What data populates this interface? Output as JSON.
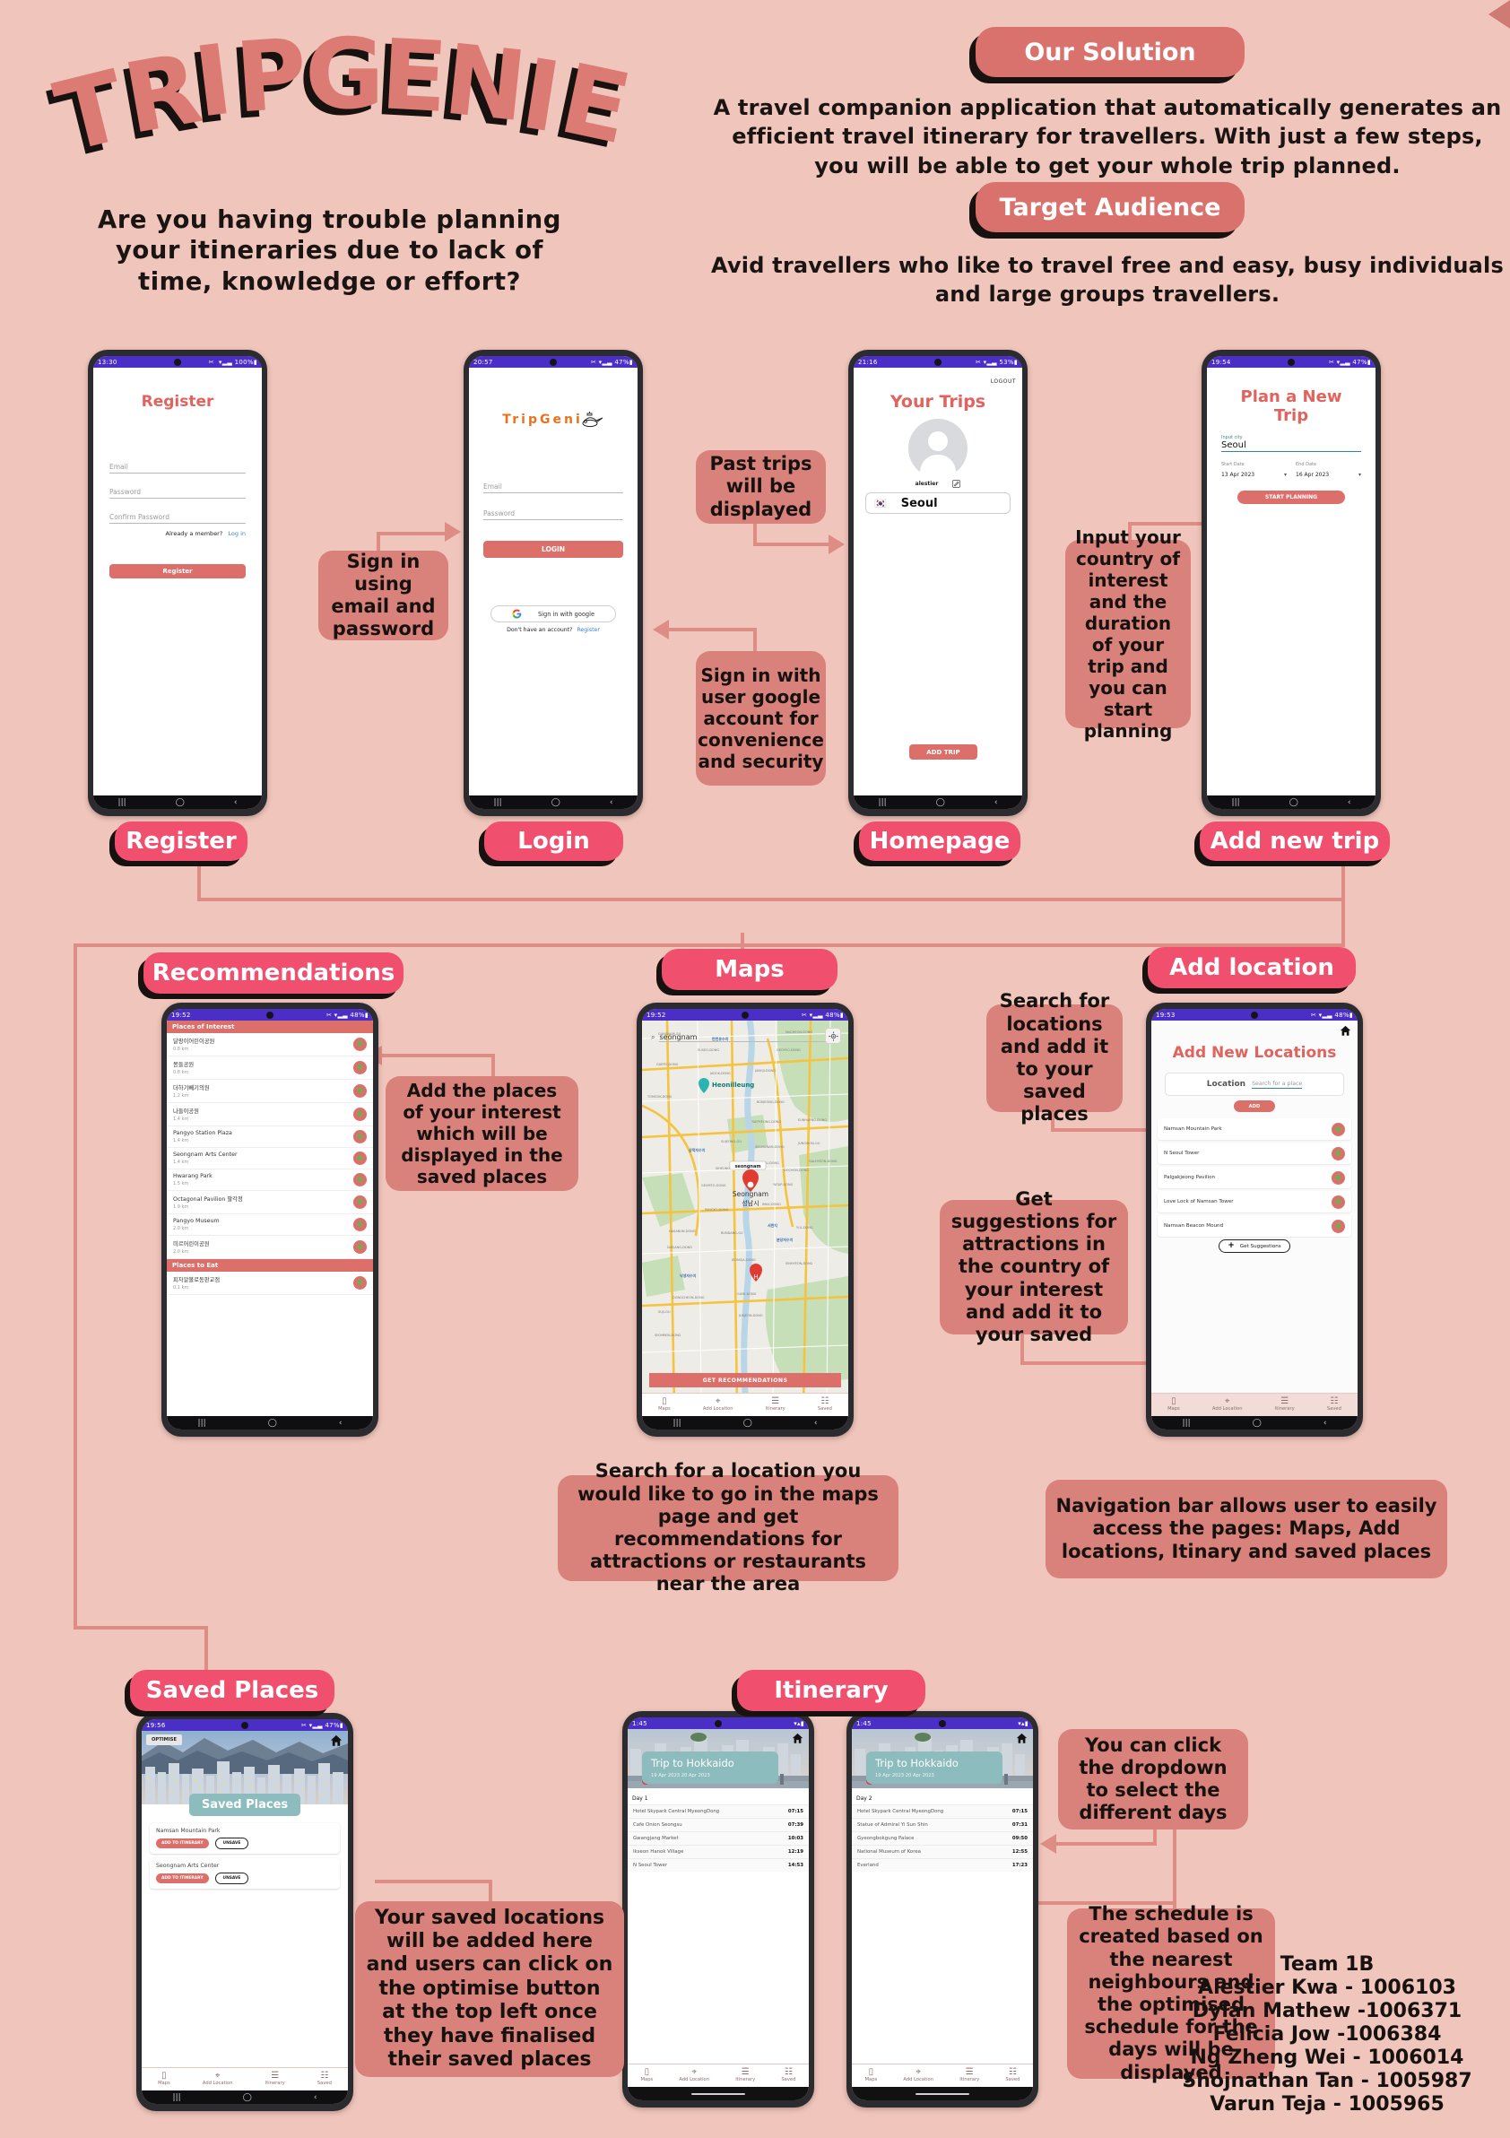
{
  "poster": {
    "logo_text": "TRIPGENIE",
    "tagline": "Are you having trouble planning your itineraries due to lack of time, knowledge or effort?",
    "solution_badge": "Our Solution",
    "solution_text": "A travel companion application that automatically generates an efficient travel itinerary for travellers. With just a few steps, you will be able to get your whole trip planned.",
    "audience_badge": "Target Audience",
    "audience_text": "Avid travellers who like to travel free and easy, busy individuals and large groups travellers.",
    "colors": {
      "background": "#f0c5bb",
      "accent_red": "#d9716c",
      "label_pink": "#f0506e",
      "callout": "#d9817b",
      "connector": "#dd8d86",
      "status_purple": "#4b2ec6",
      "app_red": "#e0635e",
      "teal": "#7fb3b5",
      "orange": "#e8731f"
    }
  },
  "section_labels": {
    "register": "Register",
    "login": "Login",
    "homepage": "Homepage",
    "add_new_trip": "Add new trip",
    "recommendations": "Recommendations",
    "maps": "Maps",
    "add_location": "Add location",
    "saved_places": "Saved Places",
    "itinerary": "Itinerary"
  },
  "callouts": {
    "signin_email": "Sign in using email and password",
    "past_trips": "Past trips will be displayed",
    "signin_google": "Sign in with user google account for convenience and security",
    "input_country": "Input your country of interest and the duration of your trip and you can start planning",
    "add_places": "Add the places of your interest which will be displayed in the saved places",
    "search_locations": "Search for locations and add it to your saved places",
    "get_suggestions": "Get suggestions for attractions in the country of your interest and add it to your saved",
    "maps_search": "Search for a location you would like to go in the maps page and get recommendations for attractions or restaurants near the area",
    "nav_bar": "Navigation bar allows user to easily access the pages: Maps, Add locations, Itinary and saved places",
    "saved_locations": "Your saved locations will be added here and users can click on the optimise button at the top left once they have finalised their saved places",
    "dropdown_days": "You can click the dropdown to select the different days",
    "schedule_created": "The schedule is created based on the nearest neighbours and the optimised schedule for the days will be displayed"
  },
  "screens": {
    "register": {
      "status_time": "13:30",
      "status_icons_left": "▣ ✉ ➤ ·",
      "status_right": "✂ ︎ ▾▂▃ 100%▮",
      "title": "Register",
      "fields": [
        {
          "placeholder": "Email"
        },
        {
          "placeholder": "Password"
        },
        {
          "placeholder": "Confirm Password"
        }
      ],
      "member_prompt": "Already a member?",
      "login_link": "Log in",
      "submit": "Register"
    },
    "login": {
      "status_time": "20:57",
      "status_right": "✂ ▾▂▃ 47%▮",
      "logo": "TripGeni",
      "fields": [
        {
          "placeholder": "Email"
        },
        {
          "placeholder": "Password"
        }
      ],
      "submit": "LOGIN",
      "google_button": "Sign in with google",
      "no_account_prompt": "Don't have an account?",
      "register_link": "Register"
    },
    "homepage": {
      "status_time": "21:16",
      "status_right": "✂ ▾▂▃ 53%▮",
      "logout": "LOGOUT",
      "title": "Your Trips",
      "username": "alestier",
      "edit_icon": "pencil-icon",
      "trips": [
        {
          "flag": "🇰🇷",
          "name": "Seoul"
        }
      ],
      "add_trip": "ADD TRIP"
    },
    "add_trip": {
      "status_time": "19:54",
      "status_right": "✂ ▾▂▃ 47%▮",
      "title": "Plan a New Trip",
      "city_label": "Input city",
      "city_value": "Seoul",
      "start_label": "Start Date",
      "start_value": "13 Apr 2023",
      "end_label": "End Date",
      "end_value": "16 Apr 2023",
      "submit": "START PLANNING"
    },
    "recommendations": {
      "status_time": "19:52",
      "status_right": "✂ ▾▂▃ 48%▮",
      "header_interest": "Places of Interest",
      "header_eat": "Places to Eat",
      "places_of_interest": [
        {
          "name": "달팡이어린이공원",
          "distance": "0.8 km"
        },
        {
          "name": "몽들공원",
          "distance": "0.8 km"
        },
        {
          "name": "더하기빼기의원",
          "distance": "1.2 km"
        },
        {
          "name": "나들이공원",
          "distance": "1.4 km"
        },
        {
          "name": "Pangyo Station Plaza",
          "distance": "1.4 km"
        },
        {
          "name": "Seongnam Arts Center",
          "distance": "1.4 km"
        },
        {
          "name": "Hwarang Park",
          "distance": "1.5 km"
        },
        {
          "name": "Octagonal Pavilion 팔각정",
          "distance": "1.9 km"
        },
        {
          "name": "Pangyo Museum",
          "distance": "2.0 km"
        },
        {
          "name": "미르어린이공원",
          "distance": "2.0 km"
        }
      ],
      "places_to_eat": [
        {
          "name": "피자알볼로동판교점",
          "distance": "0.1 km"
        }
      ]
    },
    "maps": {
      "status_time": "19:52",
      "status_right": "✂ ▾▂▃ 48%▮",
      "search_value": "seongnam",
      "search_icon": "search-icon",
      "clear_icon": "close-icon",
      "locate_icon": "my-location-icon",
      "map_labels": [
        "GANGNAM-GU",
        "SUSEO-DONG",
        "GAEPO-DONG",
        "JAGOK-DONG",
        "JANGJI-DONG",
        "GEOYEO-DONG",
        "MACHEON-DONG",
        "Heonilleung",
        "TOMGOK-DONG",
        "BOKJEONG-DONG",
        "TAEPYEONG-DONG",
        "EUNHAENG-DONG",
        "SUJEONG-GU",
        "SEONGNAM-DONG",
        "JUNGWON-GU",
        "SIHEUNG-DONG",
        "SU-DONG",
        "GALHYEON-DONG",
        "GEUMTO-DONG",
        "Seongnam 성남시",
        "YATAP-DONG",
        "DOCHON-DONG",
        "PANGYO-DONG",
        "IMAE-DONG",
        "HASANUN-DONG",
        "BUNDANG-GU",
        "YUL-DONG",
        "DAEJANG-DONG",
        "JEONGJA-DONG",
        "SINHYEON-DONG",
        "DONGCHEON-DONG",
        "SUJI-GU",
        "GUMI-DONG",
        "JUKJEON-DONG",
        "SEOMBOK-DONG"
      ],
      "pin_label": "seongnam",
      "cta": "GET RECOMMENDATIONS",
      "bottom_nav": [
        "Maps",
        "Add Location",
        "Itinerary",
        "Saved"
      ]
    },
    "add_location": {
      "status_time": "19:53",
      "status_right": "✂ ▾▂▃ 48%▮",
      "home_icon": "home-icon",
      "title": "Add New Locations",
      "location_label": "Location",
      "location_placeholder": "Search for a place",
      "add_button": "ADD",
      "locations": [
        "Namsan Mountain Park",
        "N Seoul Tower",
        "Palgakjeong Pavilion",
        "Love Lock of Namsan Tower",
        "Namsan Beacon Mound"
      ],
      "suggestions_button": "Get Suggestions",
      "bottom_nav": [
        "Maps",
        "Add Location",
        "Itinerary",
        "Saved"
      ]
    },
    "saved_places": {
      "status_time": "19:56",
      "status_right": "✂ ▾▂▃ 47%▮",
      "optimise_button": "OPTIMISE",
      "home_icon": "home-icon",
      "banner_title": "Saved Places",
      "items": [
        {
          "name": "Namsan Mountain Park",
          "add_btn": "ADD TO ITINERARY",
          "unsave_btn": "UNSAVE"
        },
        {
          "name": "Seongnam Arts Center",
          "add_btn": "ADD TO ITINERARY",
          "unsave_btn": "UNSAVE"
        }
      ],
      "bottom_nav": [
        "Maps",
        "Add Location",
        "Itinerary",
        "Saved"
      ]
    },
    "itinerary_day1": {
      "status_time": "1:45",
      "home_icon": "home-icon",
      "trip_title": "Trip to Hokkaido",
      "trip_dates": "19 Apr 2023  20 Apr 2023",
      "day_label": "Day 1",
      "entries": [
        {
          "name": "Hotel Skypark Central MyeongDong",
          "time": "07:15"
        },
        {
          "name": "Cafe Onion Seongsu",
          "time": "07:39"
        },
        {
          "name": "Gwangjang Market",
          "time": "10:03"
        },
        {
          "name": "Ikseon Hanok Village",
          "time": "12:19"
        },
        {
          "name": "N Seoul Tower",
          "time": "14:53"
        }
      ],
      "bottom_nav": [
        "Maps",
        "Add Location",
        "Itinerary",
        "Saved"
      ]
    },
    "itinerary_day2": {
      "status_time": "1:45",
      "home_icon": "home-icon",
      "trip_title": "Trip to Hokkaido",
      "trip_dates": "19 Apr 2023  20 Apr 2023",
      "day_label": "Day 2",
      "entries": [
        {
          "name": "Hotel Skypark Central MyeongDong",
          "time": "07:15"
        },
        {
          "name": "Statue of Admiral Yi Sun Shin",
          "time": "07:31"
        },
        {
          "name": "Gyeongbokgung Palace",
          "time": "09:50"
        },
        {
          "name": "National Museum of Korea",
          "time": "12:55"
        },
        {
          "name": "Everland",
          "time": "17:23"
        }
      ],
      "bottom_nav": [
        "Maps",
        "Add Location",
        "Itinerary",
        "Saved"
      ]
    }
  },
  "credits": {
    "team": "Team 1B",
    "members": [
      "Alestier Kwa - 1006103",
      "Dylan Mathew -1006371",
      "Felicia Jow -1006384",
      "Ng Zheng Wei - 1006014",
      "Shojnathan Tan - 1005987",
      "Varun Teja - 1005965"
    ]
  }
}
